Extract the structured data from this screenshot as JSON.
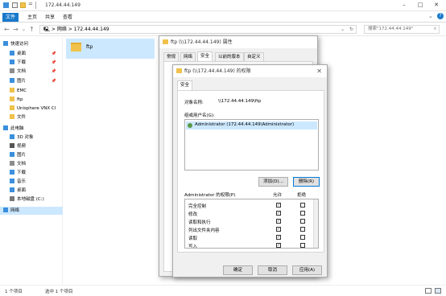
{
  "window": {
    "title": "172.44.44.149"
  },
  "ribbon": {
    "tabs": [
      "文件",
      "主页",
      "共享",
      "查看"
    ]
  },
  "address": {
    "path": "🖳  >  网络  >  172.44.44.149",
    "search_placeholder": "搜索\"172.44.44.149\""
  },
  "sidebar": {
    "items": [
      {
        "label": "快速访问",
        "icon": "star-icon",
        "color": "#3b8fdc"
      },
      {
        "label": "桌面",
        "icon": "desktop-icon",
        "color": "#3b8fdc",
        "pinned": true
      },
      {
        "label": "下载",
        "icon": "download-icon",
        "color": "#3b8fdc",
        "pinned": true
      },
      {
        "label": "文档",
        "icon": "document-icon",
        "color": "#8c8c8c",
        "pinned": true
      },
      {
        "label": "图片",
        "icon": "picture-icon",
        "color": "#3b8fdc",
        "pinned": true
      },
      {
        "label": "EMC",
        "icon": "folder-icon",
        "color": "#f0c24b"
      },
      {
        "label": "ftp",
        "icon": "folder-icon",
        "color": "#f0c24b"
      },
      {
        "label": "Unisphere VNX Cl",
        "icon": "folder-icon",
        "color": "#f0c24b"
      },
      {
        "label": "文件",
        "icon": "folder-icon",
        "color": "#f0c24b"
      },
      {
        "label": "此电脑",
        "icon": "computer-icon",
        "color": "#3b8fdc"
      },
      {
        "label": "3D 对象",
        "icon": "3d-objects-icon",
        "color": "#3b8fdc"
      },
      {
        "label": "视频",
        "icon": "video-icon",
        "color": "#555"
      },
      {
        "label": "图片",
        "icon": "picture-icon",
        "color": "#3b8fdc"
      },
      {
        "label": "文档",
        "icon": "document-icon",
        "color": "#8c8c8c"
      },
      {
        "label": "下载",
        "icon": "download-icon",
        "color": "#3b8fdc"
      },
      {
        "label": "音乐",
        "icon": "music-icon",
        "color": "#3b8fdc"
      },
      {
        "label": "桌面",
        "icon": "desktop-icon",
        "color": "#3b8fdc"
      },
      {
        "label": "本地磁盘 (C:)",
        "icon": "drive-icon",
        "color": "#777"
      },
      {
        "label": "网络",
        "icon": "network-icon",
        "color": "#3b8fdc",
        "selected": true
      }
    ]
  },
  "content": {
    "items": [
      {
        "label": "ftp",
        "icon": "folder-icon"
      }
    ]
  },
  "statusbar": {
    "count": "1 个项目",
    "selected": "选中 1 个项目"
  },
  "properties_dialog": {
    "title": "ftp (\\\\172.44.44.149) 属性",
    "tabs": [
      "常规",
      "网络",
      "安全",
      "以前的版本",
      "自定义"
    ]
  },
  "permissions_dialog": {
    "title": "ftp (\\\\172.44.44.149) 的权限",
    "tab": "安全",
    "object_label": "对象名称:",
    "object_value": "\\\\172.44.44.149\\ftp",
    "group_label": "组或用户名(G):",
    "users": [
      "Administrator (172.44.44.149\\Administrator)"
    ],
    "add_button": "添加(D)...",
    "remove_button": "删除(R)",
    "perm_label": "Administrator 的权限(P)",
    "allow_label": "允许",
    "deny_label": "拒绝",
    "permissions": [
      {
        "name": "完全控制",
        "allow": true
      },
      {
        "name": "修改",
        "allow": true
      },
      {
        "name": "读取和执行",
        "allow": true
      },
      {
        "name": "列出文件夹内容",
        "allow": true
      },
      {
        "name": "读取",
        "allow": true
      },
      {
        "name": "写入",
        "allow": true
      }
    ],
    "ok_button": "确定",
    "cancel_button": "取消",
    "apply_button": "应用(A)"
  }
}
